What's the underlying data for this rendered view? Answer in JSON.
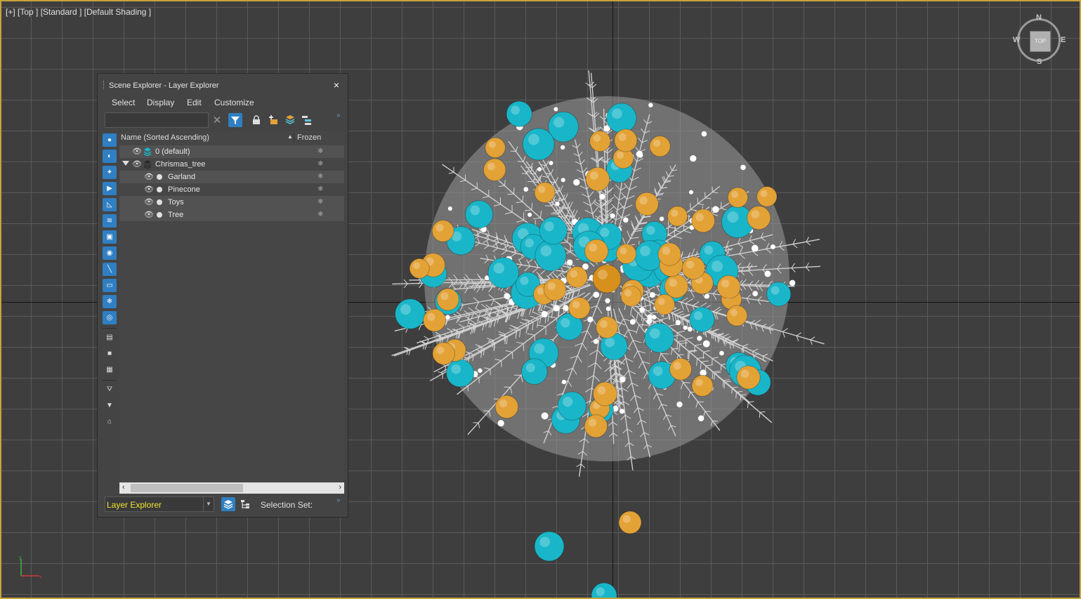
{
  "viewport": {
    "label": "[+] [Top ] [Standard ] [Default Shading ]",
    "viewcube": {
      "face": "TOP",
      "north": "N",
      "south": "S",
      "east": "E",
      "west": "W"
    },
    "colors": {
      "ornament_teal": "#19b6c9",
      "ornament_gold": "#e3a236",
      "branches": "#d8d8d8",
      "frame": "#c8a23a"
    }
  },
  "panel": {
    "title": "Scene Explorer - Layer Explorer",
    "close_icon": "×",
    "menu": [
      "Select",
      "Display",
      "Edit",
      "Customize"
    ],
    "search": {
      "value": "",
      "placeholder": ""
    },
    "columns": {
      "name": "Name (Sorted Ascending)",
      "sort_indicator": "▲",
      "frozen": "Frozen"
    },
    "rows": [
      {
        "label": "0 (default)"
      },
      {
        "label": "Chrismas_tree"
      },
      {
        "label": "Garland"
      },
      {
        "label": "Pinecone"
      },
      {
        "label": "Toys"
      },
      {
        "label": "Tree"
      }
    ],
    "bottom": {
      "explorer": "Layer Explorer",
      "selection_set": "Selection Set:"
    }
  }
}
